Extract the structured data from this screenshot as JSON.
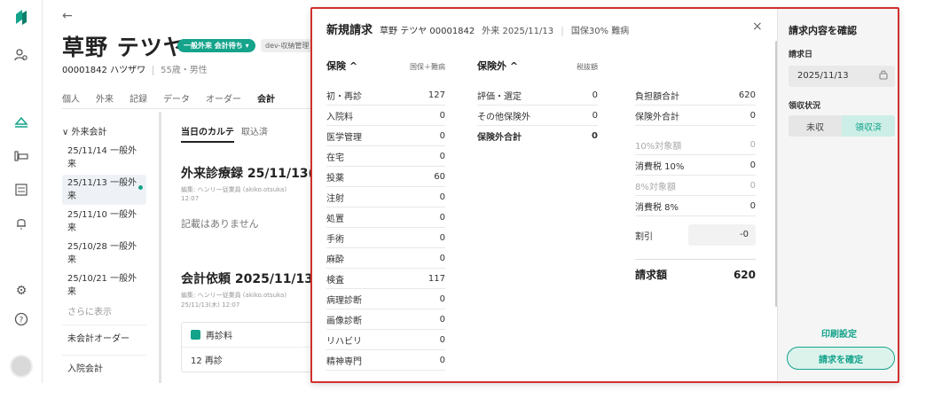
{
  "patient": {
    "name": "草野 テツヤ",
    "status_badge": "一般外来 会計待ち ▾",
    "tag": "dev-収納管理",
    "id_kana": "00001842 ハツザワ",
    "age_sex": "55歳・男性"
  },
  "tabs": [
    "個人",
    "外来",
    "記録",
    "データ",
    "オーダー",
    "会計"
  ],
  "sidebar": {
    "header": "∨ 外来会計",
    "visits": [
      "25/11/14 一般外来",
      "25/11/13 一般外来",
      "25/11/10 一般外来",
      "25/10/28 一般外来",
      "25/10/21 一般外来"
    ],
    "more": "さらに表示",
    "unbilled": "未会計オーダー",
    "inpatient": "入院会計"
  },
  "main": {
    "subtab_active": "当日のカルテ",
    "subtab_other": "取込済",
    "record_title": "外来診療録  25/11/13(木",
    "record_meta": "編集: ヘンリー従業員 (akiko.otsuka)",
    "record_time": "12:07",
    "empty": "記載はありません",
    "billing_title": "会計依頼  2025/11/13(木",
    "billing_meta": "編集: ヘンリー従業員 (akiko.otsuka)",
    "billing_time": "25/11/13(木) 12:07",
    "card_header": "再診料",
    "card_body": "12 再診"
  },
  "modal": {
    "title": "新規請求",
    "patient": "草野 テツヤ 00001842",
    "visit": "外来 2025/11/13",
    "insurance": "国保30% 難病",
    "close": "×",
    "insured": {
      "header": "保険 ^",
      "col": "国保＋難病",
      "rows": [
        {
          "label": "初・再診",
          "value": "127"
        },
        {
          "label": "入院料",
          "value": "0"
        },
        {
          "label": "医学管理",
          "value": "0"
        },
        {
          "label": "在宅",
          "value": "0"
        },
        {
          "label": "投薬",
          "value": "60"
        },
        {
          "label": "注射",
          "value": "0"
        },
        {
          "label": "処置",
          "value": "0"
        },
        {
          "label": "手術",
          "value": "0"
        },
        {
          "label": "麻酔",
          "value": "0"
        },
        {
          "label": "検査",
          "value": "117"
        },
        {
          "label": "病理診断",
          "value": "0"
        },
        {
          "label": "画像診断",
          "value": "0"
        },
        {
          "label": "リハビリ",
          "value": "0"
        },
        {
          "label": "精神専門",
          "value": "0"
        }
      ]
    },
    "uninsured": {
      "header": "保険外 ^",
      "col": "税抜額",
      "rows": [
        {
          "label": "評価・選定",
          "value": "0"
        },
        {
          "label": "その他保険外",
          "value": "0"
        }
      ],
      "total_label": "保険外合計",
      "total_value": "0"
    },
    "summary": {
      "rows": [
        {
          "label": "負担額合計",
          "value": "620"
        },
        {
          "label": "保険外合計",
          "value": "0"
        }
      ],
      "tax": [
        {
          "label": "10%対象額",
          "value": "0",
          "muted": true
        },
        {
          "label": "消費税 10%",
          "value": "0",
          "muted": false
        },
        {
          "label": "8%対象額",
          "value": "0",
          "muted": true
        },
        {
          "label": "消費税 8%",
          "value": "0",
          "muted": false
        }
      ],
      "discount_label": "割引",
      "discount_value": "-0",
      "total_label": "請求額",
      "total_value": "620"
    }
  },
  "confirm": {
    "title": "請求内容を確認",
    "date_label": "請求日",
    "date": "2025/11/13",
    "receipt_label": "領収状況",
    "unpaid": "未収",
    "paid": "領収済",
    "print": "印刷設定",
    "submit": "請求を確定"
  },
  "colors": {
    "accent": "#14a38b",
    "highlight": "#d32f2f"
  }
}
